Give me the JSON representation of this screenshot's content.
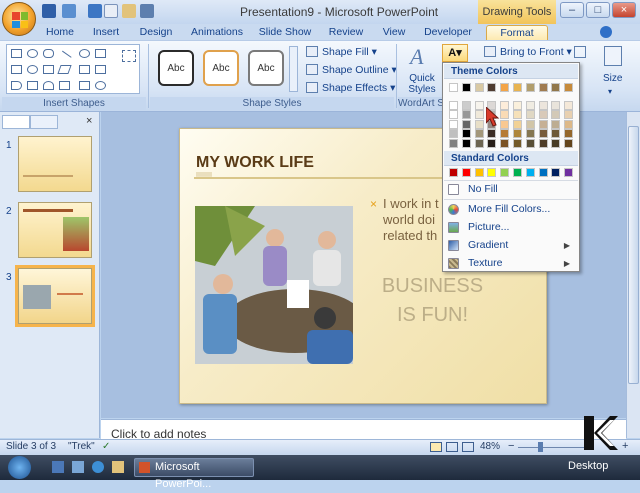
{
  "window": {
    "title": "Presentation9 - Microsoft PowerPoint",
    "context_tab_group": "Drawing Tools",
    "buttons": [
      "–",
      "□",
      "×"
    ]
  },
  "tabs": [
    "Home",
    "Insert",
    "Design",
    "Animations",
    "Slide Show",
    "Review",
    "View",
    "Developer",
    "Format"
  ],
  "ribbon": {
    "groups": [
      "Insert Shapes",
      "Shape Styles",
      "WordArt St"
    ],
    "style_buttons": [
      "Abc",
      "Abc",
      "Abc"
    ],
    "commands": {
      "shape_fill": "Shape Fill",
      "shape_outline": "Shape Outline",
      "shape_effects": "Shape Effects",
      "quick_styles_line1": "Quick",
      "quick_styles_line2": "Styles",
      "bring_to_front": "Bring to Front",
      "size": "Size"
    }
  },
  "slides_pane": {
    "numbers": [
      "1",
      "2",
      "3"
    ],
    "selected": 3
  },
  "slide": {
    "title": "MY WORK LIFE",
    "bullet_lines": [
      "I work in t",
      "world doi",
      "related th"
    ],
    "emphasis_line1": "BUSINESS",
    "emphasis_line2": "IS FUN!"
  },
  "notes_placeholder": "Click to add notes",
  "statusbar": {
    "slide_info": "Slide 3 of 3",
    "theme": "\"Trek\"",
    "zoom": "48%"
  },
  "taskbar": {
    "task": "Microsoft PowerPoi...",
    "desktop": "Desktop"
  },
  "fill_menu": {
    "theme_colors_header": "Theme Colors",
    "standard_colors_header": "Standard Colors",
    "theme_top_row": [
      "#ffffff",
      "#000000",
      "#d9c9a3",
      "#4e3b30",
      "#f3a447",
      "#e8b34f",
      "#b29e6c",
      "#a07b4f",
      "#91774a",
      "#c68a3a"
    ],
    "standard_colors": [
      "#c00000",
      "#ff0000",
      "#ffc000",
      "#ffff00",
      "#92d050",
      "#00b050",
      "#00b0f0",
      "#0070c0",
      "#002060",
      "#7030a0"
    ],
    "items": [
      {
        "label": "No Fill",
        "arrow": false
      },
      {
        "label": "More Fill Colors...",
        "arrow": false
      },
      {
        "label": "Picture...",
        "arrow": false
      },
      {
        "label": "Gradient",
        "arrow": true
      },
      {
        "label": "Texture",
        "arrow": true
      }
    ]
  }
}
